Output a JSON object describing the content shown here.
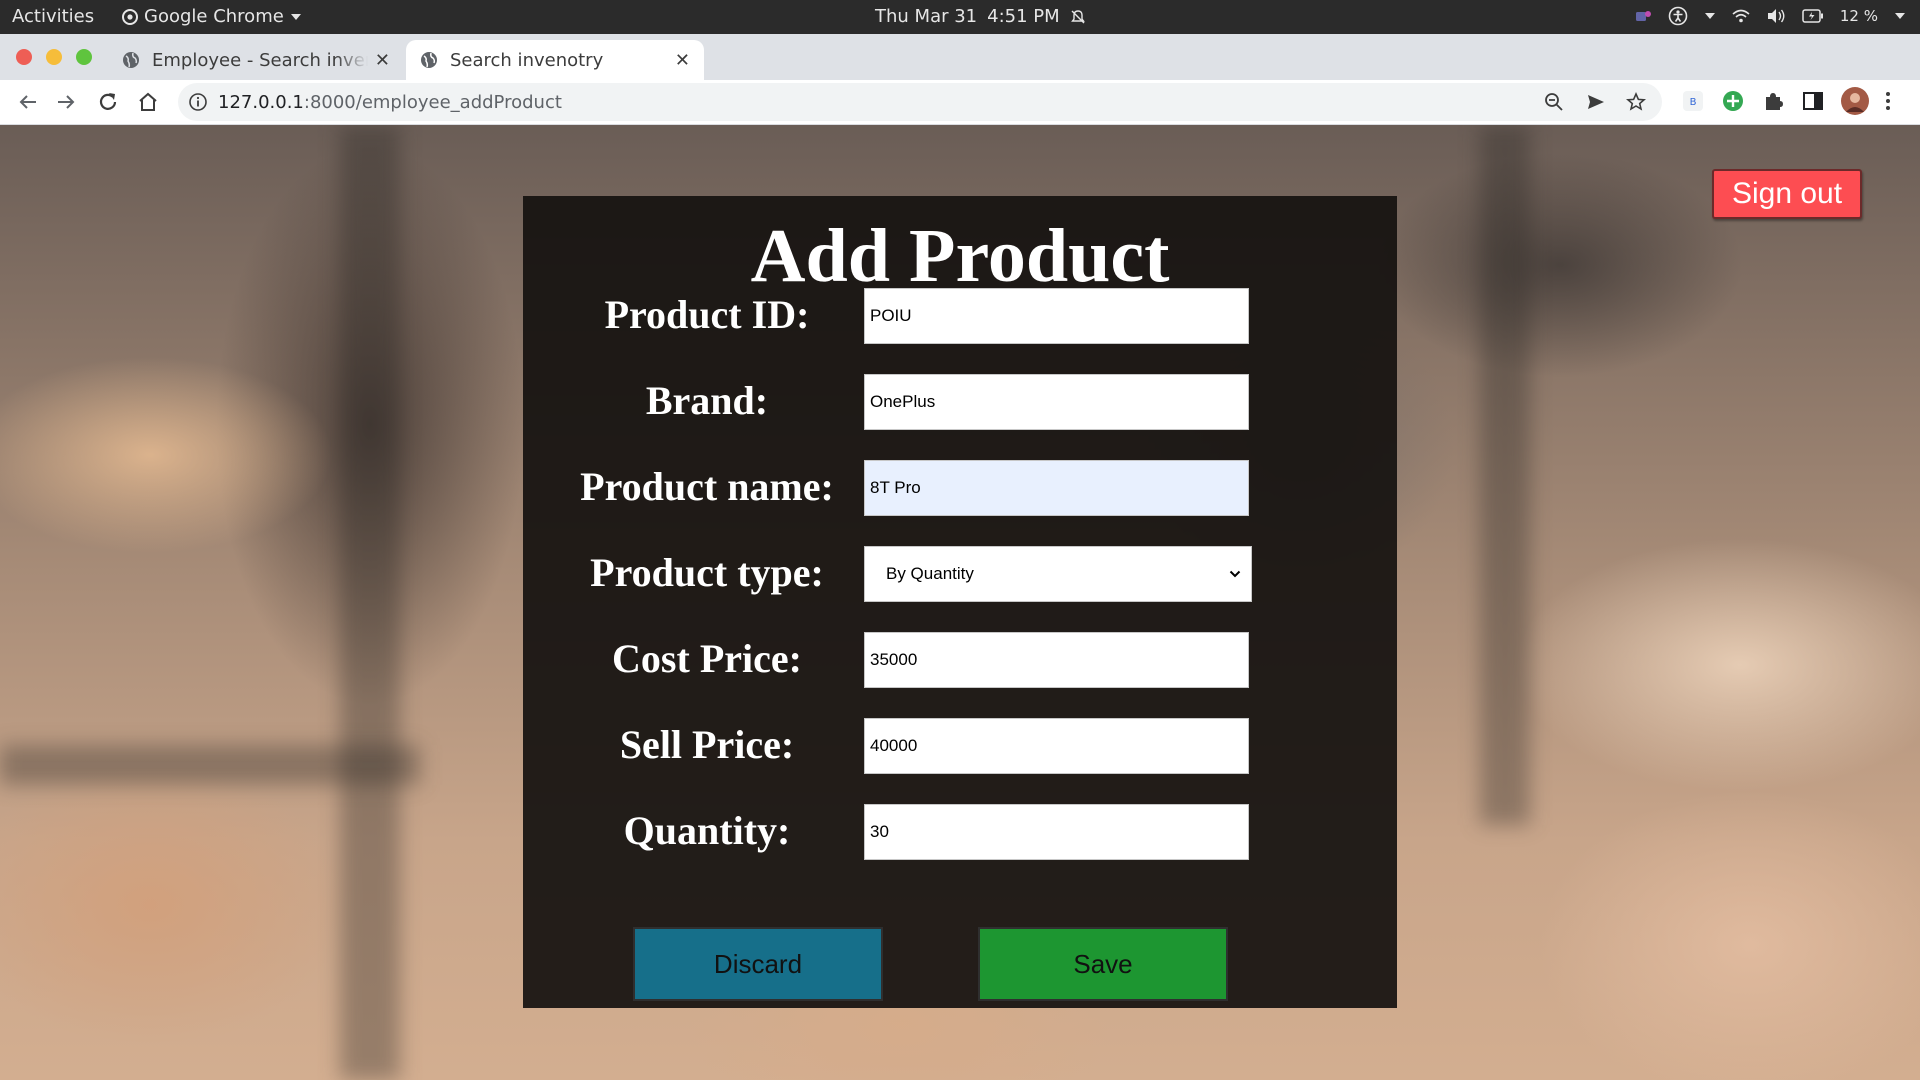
{
  "system_bar": {
    "activities": "Activities",
    "app_name": "Google Chrome",
    "date": "Thu Mar 31",
    "time": "4:51 PM",
    "battery": "12 %"
  },
  "browser": {
    "tabs": [
      {
        "title": "Employee - Search invenotry",
        "active": false
      },
      {
        "title": "Search invenotry",
        "active": true
      }
    ],
    "url_host": "127.0.0.1",
    "url_path": ":8000/employee_addProduct"
  },
  "page": {
    "sign_out_label": "Sign out",
    "title": "Add Product",
    "fields": {
      "product_id": {
        "label": "Product ID:",
        "value": "POIU"
      },
      "brand": {
        "label": "Brand:",
        "value": "OnePlus"
      },
      "product_name": {
        "label": "Product name:",
        "value": "8T Pro"
      },
      "product_type": {
        "label": "Product type:",
        "value": "By Quantity"
      },
      "cost_price": {
        "label": "Cost Price:",
        "value": "35000"
      },
      "sell_price": {
        "label": "Sell Price:",
        "value": "40000"
      },
      "quantity": {
        "label": "Quantity:",
        "value": "30"
      }
    },
    "discard_label": "Discard",
    "save_label": "Save"
  },
  "colors": {
    "sign_out": "#fd4d52",
    "discard": "#166f8a",
    "save": "#1d9631",
    "card": "#161210",
    "autofill": "#e8f0fe"
  }
}
